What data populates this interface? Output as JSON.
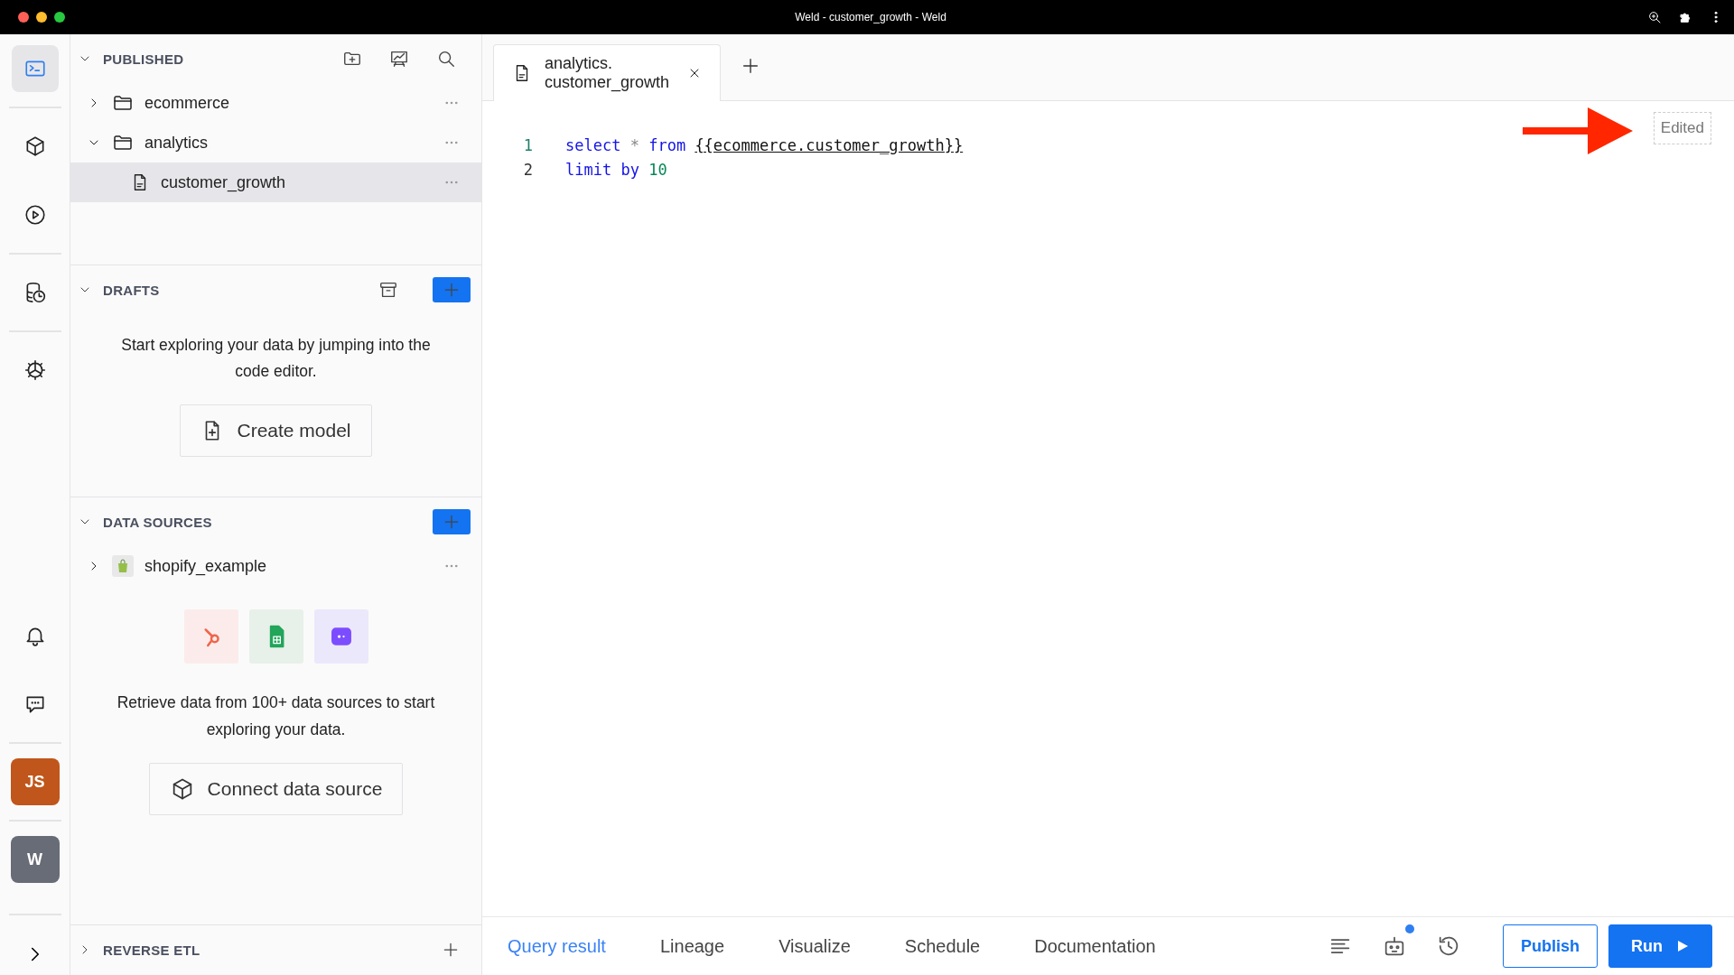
{
  "window": {
    "title": "Weld - customer_growth - Weld"
  },
  "rail": {
    "groups": [
      [
        {
          "kind": "editor",
          "selected": true
        }
      ],
      [
        {
          "kind": "model",
          "selected": false
        },
        {
          "kind": "run",
          "selected": false
        }
      ],
      [
        {
          "kind": "history",
          "selected": false
        }
      ],
      [
        {
          "kind": "settings",
          "selected": false
        }
      ]
    ],
    "bottom": [
      {
        "kind": "notifications",
        "selected": false
      },
      {
        "kind": "chat",
        "selected": false
      }
    ],
    "avatars": [
      {
        "initials": "JS",
        "color": "#c0561b"
      },
      {
        "initials": "W",
        "color": "#686c76"
      }
    ]
  },
  "published": {
    "title": "PUBLISHED",
    "expanded": true,
    "items": [
      {
        "label": "ecommerce",
        "kind": "folder",
        "expanded": false,
        "selected": false
      },
      {
        "label": "analytics",
        "kind": "folder",
        "expanded": true,
        "selected": false,
        "children": [
          {
            "label": "customer_growth",
            "kind": "file",
            "selected": true
          }
        ]
      }
    ]
  },
  "drafts": {
    "title": "DRAFTS",
    "expanded": true,
    "message": "Start exploring your data by jumping into the code editor.",
    "button": "Create model"
  },
  "data_sources": {
    "title": "DATA SOURCES",
    "expanded": true,
    "items": [
      {
        "label": "shopify_example",
        "expanded": false,
        "selected": false
      }
    ],
    "connectors": [
      {
        "kind": "hub",
        "color": "#fbeceb"
      },
      {
        "kind": "sheet",
        "color": "#e8f0ea"
      },
      {
        "kind": "chat",
        "color": "#ebe8fc"
      }
    ],
    "message": "Retrieve data from 100+ data sources to start exploring your data.",
    "button": "Connect data source"
  },
  "reverse_etl": {
    "title": "REVERSE ETL",
    "expanded": false
  },
  "editor": {
    "tabs": [
      {
        "lines": [
          "analytics.",
          "customer_growth"
        ],
        "selected": true
      }
    ],
    "code": [
      {
        "number": "1",
        "active": true,
        "tokens": [
          {
            "text": "select",
            "kind": "keyword"
          },
          {
            "text": "*",
            "kind": "operator"
          },
          {
            "text": "from",
            "kind": "keyword"
          },
          {
            "text": "{{ecommerce.customer_growth}}",
            "kind": "reference"
          }
        ]
      },
      {
        "number": "2",
        "active": false,
        "tokens": [
          {
            "text": "limit",
            "kind": "keyword"
          },
          {
            "text": "by",
            "kind": "keyword"
          },
          {
            "text": "10",
            "kind": "number"
          }
        ]
      }
    ],
    "status": "Edited"
  },
  "bottom_bar": {
    "tabs": [
      {
        "label": "Query result",
        "selected": true
      },
      {
        "label": "Lineage",
        "selected": false
      },
      {
        "label": "Visualize",
        "selected": false
      },
      {
        "label": "Schedule",
        "selected": false
      },
      {
        "label": "Documentation",
        "selected": false
      }
    ],
    "tools": [
      {
        "kind": "format",
        "badge": false
      },
      {
        "kind": "assistant",
        "badge": true
      },
      {
        "kind": "history",
        "badge": false
      }
    ],
    "buttons": [
      {
        "label": "Publish",
        "kind": "outline"
      },
      {
        "label": "Run",
        "kind": "primary"
      }
    ]
  }
}
